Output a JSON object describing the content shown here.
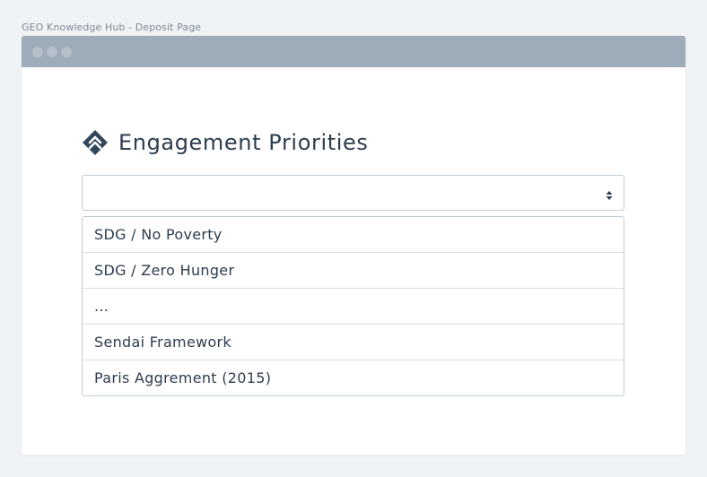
{
  "page": {
    "caption": "GEO Knowledge Hub - Deposit Page"
  },
  "window": {
    "controls": [
      "window-dot",
      "window-dot",
      "window-dot"
    ]
  },
  "section": {
    "icon": "double-chevron-up-icon",
    "title": "Engagement Priorities"
  },
  "select": {
    "value": "",
    "indicator_icon": "sort-arrows-icon"
  },
  "options": [
    "SDG / No Poverty",
    "SDG / Zero Hunger",
    "...",
    "Sendai Framework",
    "Paris Aggrement (2015)"
  ],
  "colors": {
    "titlebar": "#9eabb8",
    "heading": "#2c3d4f",
    "border": "#c3ccd4",
    "background": "#f0f3f5"
  }
}
